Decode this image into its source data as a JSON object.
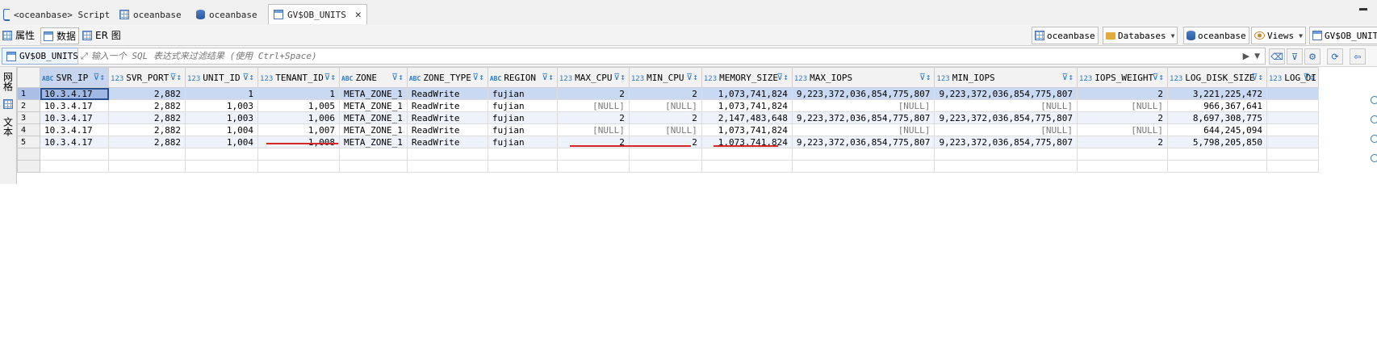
{
  "editor_tabs": [
    {
      "label": "<oceanbase> Script",
      "icon": "script-icon"
    },
    {
      "label": "oceanbase",
      "icon": "connection-icon"
    },
    {
      "label": "oceanbase",
      "icon": "database-icon"
    },
    {
      "label": "GV$OB_UNITS",
      "icon": "table-icon",
      "active": true
    }
  ],
  "subtabs": [
    {
      "label": "属性",
      "icon": "properties-icon"
    },
    {
      "label": "数据",
      "icon": "data-grid-icon",
      "active": true
    },
    {
      "label": "ER 图",
      "icon": "er-diagram-icon"
    }
  ],
  "breadcrumbs": [
    {
      "label": "oceanbase",
      "icon": "connection-icon"
    },
    {
      "label": "Databases",
      "icon": "folder-icon"
    },
    {
      "label": "oceanbase",
      "icon": "database-icon"
    },
    {
      "label": "Views",
      "icon": "view-icon"
    },
    {
      "label": "GV$OB_UNITS",
      "icon": "table-icon"
    }
  ],
  "filter": {
    "table_label": "GV$OB_UNITS",
    "placeholder": "输入一个 SQL 表达式来过滤结果 (使用 Ctrl+Space)"
  },
  "side_panel": {
    "grid_label": "网格",
    "text_label": "文本"
  },
  "grid": {
    "columns": [
      {
        "name": "SVR_IP",
        "type": "ABC"
      },
      {
        "name": "SVR_PORT",
        "type": "123"
      },
      {
        "name": "UNIT_ID",
        "type": "123"
      },
      {
        "name": "TENANT_ID",
        "type": "123"
      },
      {
        "name": "ZONE",
        "type": "ABC"
      },
      {
        "name": "ZONE_TYPE",
        "type": "ABC"
      },
      {
        "name": "REGION",
        "type": "ABC"
      },
      {
        "name": "MAX_CPU",
        "type": "123"
      },
      {
        "name": "MIN_CPU",
        "type": "123"
      },
      {
        "name": "MEMORY_SIZE",
        "type": "123"
      },
      {
        "name": "MAX_IOPS",
        "type": "123"
      },
      {
        "name": "MIN_IOPS",
        "type": "123"
      },
      {
        "name": "IOPS_WEIGHT",
        "type": "123"
      },
      {
        "name": "LOG_DISK_SIZE",
        "type": "123"
      },
      {
        "name": "LOG_DI",
        "type": "123"
      }
    ],
    "rows": [
      {
        "n": "1",
        "cells": [
          "10.3.4.17",
          "2,882",
          "1",
          "1",
          "META_ZONE_1",
          "ReadWrite",
          "fujian",
          "2",
          "2",
          "1,073,741,824",
          "9,223,372,036,854,775,807",
          "9,223,372,036,854,775,807",
          "2",
          "3,221,225,472",
          ""
        ]
      },
      {
        "n": "2",
        "cells": [
          "10.3.4.17",
          "2,882",
          "1,003",
          "1,005",
          "META_ZONE_1",
          "ReadWrite",
          "fujian",
          "[NULL]",
          "[NULL]",
          "1,073,741,824",
          "[NULL]",
          "[NULL]",
          "[NULL]",
          "966,367,641",
          ""
        ]
      },
      {
        "n": "3",
        "cells": [
          "10.3.4.17",
          "2,882",
          "1,003",
          "1,006",
          "META_ZONE_1",
          "ReadWrite",
          "fujian",
          "2",
          "2",
          "2,147,483,648",
          "9,223,372,036,854,775,807",
          "9,223,372,036,854,775,807",
          "2",
          "8,697,308,775",
          ""
        ]
      },
      {
        "n": "4",
        "cells": [
          "10.3.4.17",
          "2,882",
          "1,004",
          "1,007",
          "META_ZONE_1",
          "ReadWrite",
          "fujian",
          "[NULL]",
          "[NULL]",
          "1,073,741,824",
          "[NULL]",
          "[NULL]",
          "[NULL]",
          "644,245,094",
          ""
        ]
      },
      {
        "n": "5",
        "cells": [
          "10.3.4.17",
          "2,882",
          "1,004",
          "1,008",
          "META_ZONE_1",
          "ReadWrite",
          "fujian",
          "2",
          "2",
          "1,073,741,824",
          "9,223,372,036,854,775,807",
          "9,223,372,036,854,775,807",
          "2",
          "5,798,205,850",
          ""
        ]
      }
    ]
  },
  "colors": {
    "selected_row": "#c9d9f1",
    "annotation_red": "#d62828",
    "accent": "#2b79c5"
  }
}
